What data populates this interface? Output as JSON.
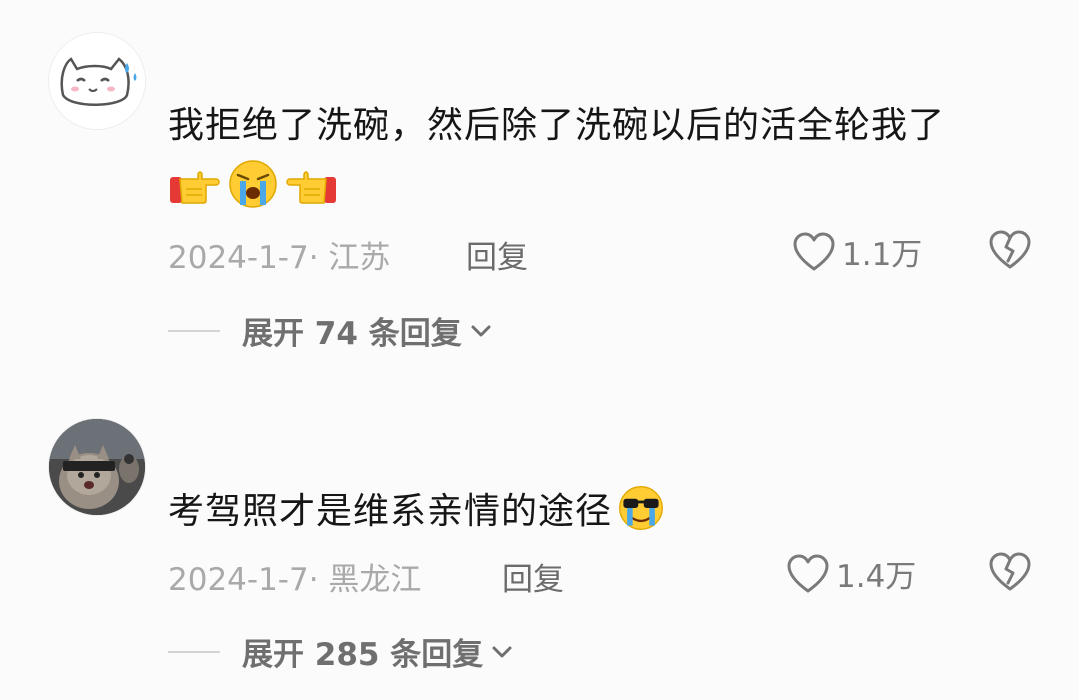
{
  "comments": [
    {
      "avatar_icon": "white-cat-sticker-avatar",
      "text": "我拒绝了洗碗，然后除了洗碗以后的活全轮我了",
      "emojis": [
        "point-right-icon",
        "crying-face-icon",
        "point-left-icon"
      ],
      "meta": "2024-1-7· 江苏",
      "reply_label": "回复",
      "like_count": "1.1万",
      "expand_label": "展开 74 条回复"
    },
    {
      "avatar_icon": "cat-photo-avatar",
      "text": "考驾照才是维系亲情的途径",
      "emojis": [
        "sunglasses-crying-face-icon"
      ],
      "meta": "2024-1-7· 黑龙江",
      "reply_label": "回复",
      "like_count": "1.4万",
      "expand_label": "展开 285 条回复"
    }
  ],
  "colors": {
    "background": "#fbfbfb",
    "text": "#161616",
    "meta": "#a9a9a9",
    "action": "#6b6b6b",
    "emoji_yellow": "#ffcc33",
    "tear_blue": "#4aa8e8"
  }
}
